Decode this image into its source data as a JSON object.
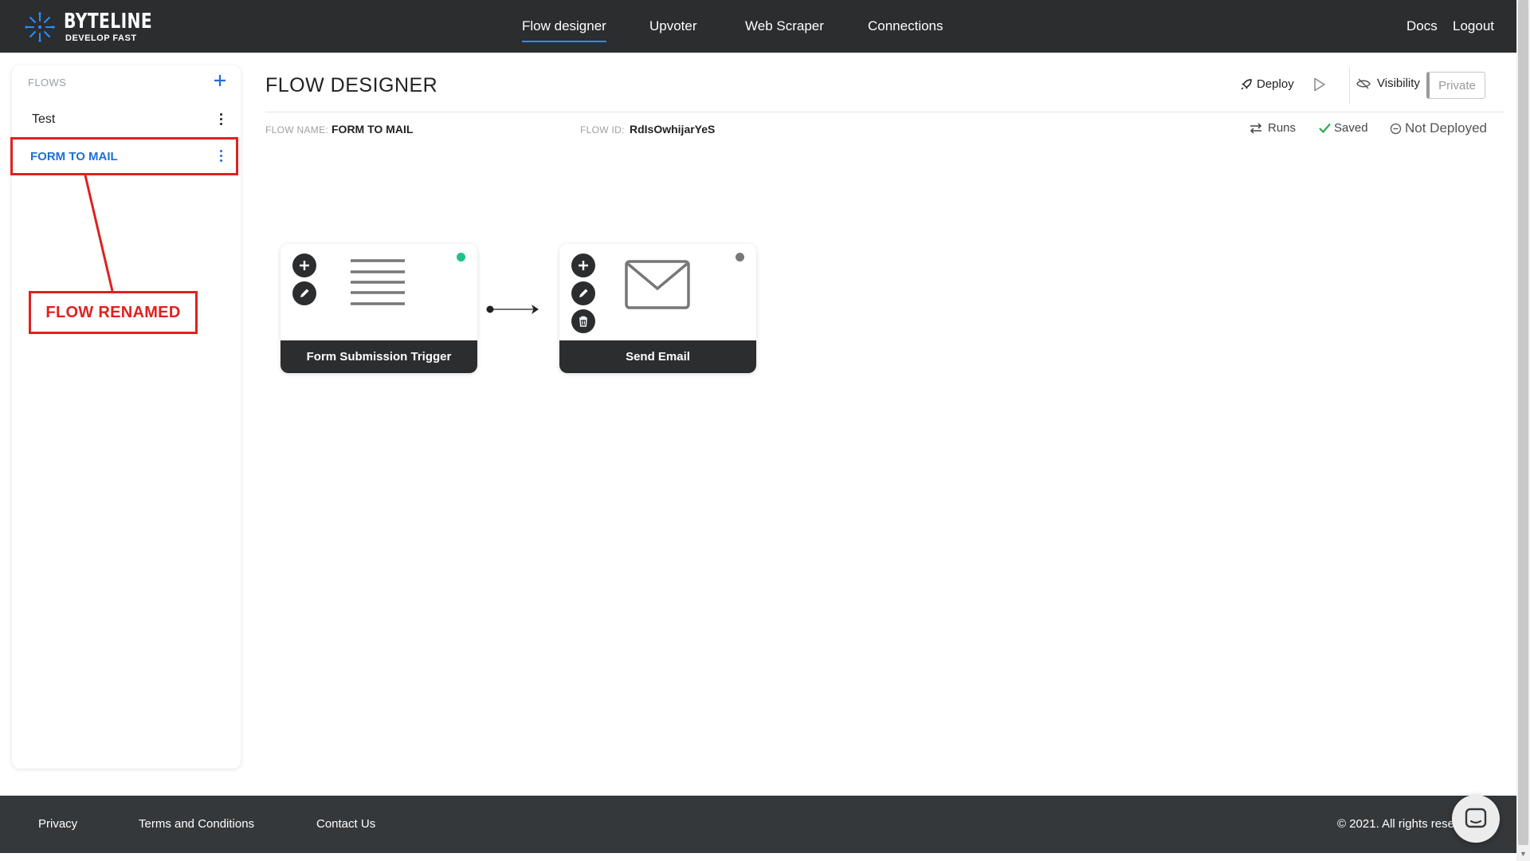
{
  "brand": {
    "name": "BYTELINE",
    "tagline": "DEVELOP FAST",
    "accent": "#2b8cff"
  },
  "nav": {
    "items": [
      {
        "label": "Flow designer",
        "active": true
      },
      {
        "label": "Upvoter"
      },
      {
        "label": "Web Scraper"
      },
      {
        "label": "Connections"
      }
    ],
    "docs": "Docs",
    "logout": "Logout"
  },
  "sidebar": {
    "title": "FLOWS",
    "add_icon": "plus-icon",
    "flows": [
      {
        "name": "Test",
        "selected": false
      },
      {
        "name": "FORM TO MAIL",
        "selected": true
      }
    ]
  },
  "annotation": {
    "text": "FLOW RENAMED",
    "color": "#e02020"
  },
  "header": {
    "title": "FLOW DESIGNER",
    "deploy": "Deploy",
    "visibility": "Visibility",
    "private": "Private"
  },
  "meta": {
    "flow_name_label": "FLOW NAME:",
    "flow_name": "FORM TO MAIL",
    "flow_id_label": "FLOW ID:",
    "flow_id": "RdIsOwhijarYeS",
    "runs": "Runs",
    "saved": "Saved",
    "deploy_status": "Not Deployed",
    "saved_color": "#2eaa4a"
  },
  "nodes": [
    {
      "title": "Form Submission Trigger",
      "icon": "form-lines-icon",
      "status_color": "#1fc28a"
    },
    {
      "title": "Send Email",
      "icon": "envelope-icon",
      "status_color": "#777777"
    }
  ],
  "footer": {
    "privacy": "Privacy",
    "terms": "Terms and Conditions",
    "contact": "Contact Us",
    "copyright": "© 2021. All rights reserved."
  }
}
